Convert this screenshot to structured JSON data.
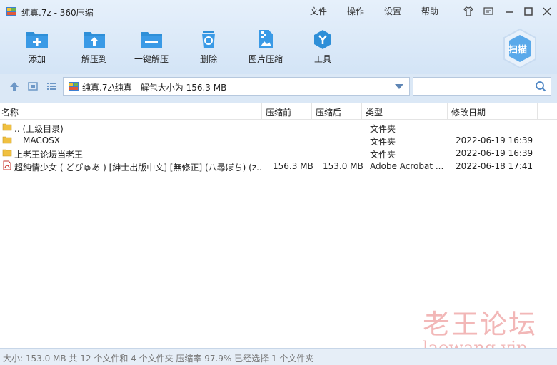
{
  "window": {
    "title": "纯真.7z - 360压缩",
    "menu": [
      "文件",
      "操作",
      "设置",
      "帮助"
    ]
  },
  "toolbar": {
    "add": "添加",
    "extract_to": "解压到",
    "one_click": "一键解压",
    "delete": "删除",
    "image_compress": "图片压缩",
    "tools": "工具",
    "scan": "扫描"
  },
  "address": {
    "path": "纯真.7z\\纯真 - 解包大小为 156.3 MB",
    "search_placeholder": ""
  },
  "columns": {
    "name": "名称",
    "compressed_before": "压缩前",
    "compressed_after": "压缩后",
    "type": "类型",
    "modified": "修改日期"
  },
  "files": [
    {
      "icon": "folder-icon",
      "name": ".. (上级目录)",
      "before": "",
      "after": "",
      "type": "文件夹",
      "date": ""
    },
    {
      "icon": "folder-icon",
      "name": "__MACOSX",
      "before": "",
      "after": "",
      "type": "文件夹",
      "date": "2022-06-19 16:39"
    },
    {
      "icon": "folder-icon",
      "name": "上老王论坛当老王",
      "before": "",
      "after": "",
      "type": "文件夹",
      "date": "2022-06-19 16:39"
    },
    {
      "icon": "pdf-icon",
      "name": "超純情少女 ( どぴゅあ ) [紳士出版中文] [無修正] (八尋ぽち) (z...",
      "before": "156.3 MB",
      "after": "153.0 MB",
      "type": "Adobe Acrobat ...",
      "date": "2022-06-18 17:41"
    }
  ],
  "watermark": {
    "cn": "老王论坛",
    "url": "laowang.vip"
  },
  "status": {
    "text": "大小: 153.0 MB 共 12 个文件和 4 个文件夹 压缩率 97.9% 已经选择 1 个文件夹"
  },
  "colors": {
    "accent": "#2e8fd8",
    "folder": "#f0c040",
    "watermark": "#f2b7b7"
  }
}
